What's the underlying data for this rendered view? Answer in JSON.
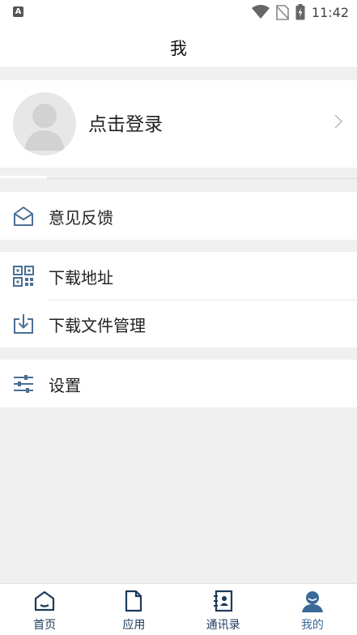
{
  "status_bar": {
    "indicator": "A",
    "time": "11:42",
    "icons": [
      "wifi-icon",
      "no-sim-icon",
      "battery-charging-icon"
    ]
  },
  "header": {
    "title": "我"
  },
  "profile": {
    "login_label": "点击登录"
  },
  "groups": [
    {
      "items": [
        {
          "label": "意见反馈",
          "icon": "mail-open-icon"
        }
      ]
    },
    {
      "items": [
        {
          "label": "下载地址",
          "icon": "qr-code-icon"
        },
        {
          "label": "下载文件管理",
          "icon": "download-tray-icon"
        }
      ]
    },
    {
      "items": [
        {
          "label": "设置",
          "icon": "sliders-icon"
        }
      ]
    }
  ],
  "tabs": [
    {
      "label": "首页",
      "icon": "home-icon",
      "active": false
    },
    {
      "label": "应用",
      "icon": "document-icon",
      "active": false
    },
    {
      "label": "通讯录",
      "icon": "contacts-book-icon",
      "active": false
    },
    {
      "label": "我的",
      "icon": "user-icon",
      "active": true
    }
  ],
  "colors": {
    "icon": "#4a6f93",
    "tab_icon": "#1d3a5c",
    "tab_active": "#3b6a96",
    "background": "#f0f0f0"
  }
}
